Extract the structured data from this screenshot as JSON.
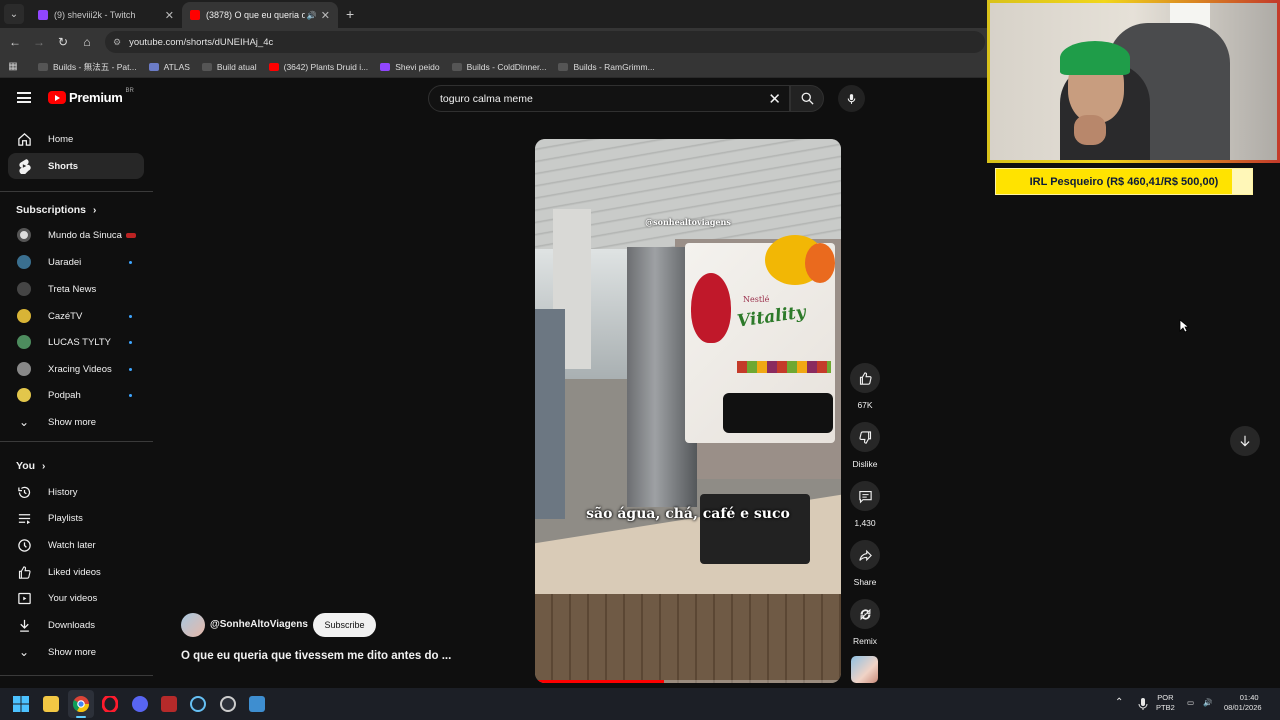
{
  "browser": {
    "tabs": [
      {
        "title": "(9) sheviii2k - Twitch",
        "active": false,
        "favicon_color": "#9146ff"
      },
      {
        "title": "(3878) O que eu queria que",
        "active": true,
        "favicon_color": "#ff0000"
      }
    ],
    "url": "youtube.com/shorts/dUNEIHAj_4c",
    "bookmarks": [
      {
        "label": "Builds - 無法五 - Pat...",
        "icon_color": "#1a1a1a"
      },
      {
        "label": "ATLAS",
        "icon_color": "#6b7cc7"
      },
      {
        "label": "Build atual",
        "icon_color": "#1a1a1a"
      },
      {
        "label": "(3642) Plants Druid i...",
        "icon_color": "#ff0000"
      },
      {
        "label": "Shevi peido",
        "icon_color": "#9146ff"
      },
      {
        "label": "Builds - ColdDinner...",
        "icon_color": "#1a1a1a"
      },
      {
        "label": "Builds - RamGrimm...",
        "icon_color": "#1a1a1a"
      }
    ]
  },
  "youtube": {
    "logo_text": "Premium",
    "logo_region": "BR",
    "search_query": "toguro calma meme",
    "sidebar": {
      "main": [
        {
          "label": "Home",
          "icon": "home-icon",
          "active": false
        },
        {
          "label": "Shorts",
          "icon": "shorts-icon",
          "active": true
        }
      ],
      "subscriptions_heading": "Subscriptions",
      "subscriptions": [
        {
          "label": "Mundo da Sinuca",
          "avatar_color": "#ddd",
          "badge": "live"
        },
        {
          "label": "Uaradei",
          "avatar_color": "#3a6f8f",
          "badge": "dot"
        },
        {
          "label": "Treta News",
          "avatar_color": "#444",
          "badge": ""
        },
        {
          "label": "CazéTV",
          "avatar_color": "#d8b436",
          "badge": "dot"
        },
        {
          "label": "LUCAS TYLTY",
          "avatar_color": "#4d8c5e",
          "badge": "dot"
        },
        {
          "label": "Xracing Videos",
          "avatar_color": "#888",
          "badge": "dot"
        },
        {
          "label": "Podpah",
          "avatar_color": "#e2c64b",
          "badge": "dot"
        }
      ],
      "subs_show_more": "Show more",
      "you_heading": "You",
      "you_items": [
        {
          "label": "History",
          "icon": "history-icon"
        },
        {
          "label": "Playlists",
          "icon": "playlists-icon"
        },
        {
          "label": "Watch later",
          "icon": "watch-later-icon"
        },
        {
          "label": "Liked videos",
          "icon": "like-icon"
        },
        {
          "label": "Your videos",
          "icon": "your-videos-icon"
        },
        {
          "label": "Downloads",
          "icon": "download-icon"
        }
      ],
      "you_show_more": "Show more"
    },
    "video": {
      "watermark": "@sonhealtoviagens",
      "brand": "Nestlé",
      "product": "Vitality",
      "caption": "são água, chá, café e suco",
      "progress": 0.42
    },
    "actions": {
      "likes": "67K",
      "dislike_label": "Dislike",
      "comments": "1,430",
      "share_label": "Share",
      "remix_label": "Remix"
    },
    "channel": {
      "handle": "@SonheAltoViagens",
      "subscribe_label": "Subscribe"
    },
    "title": "O que eu queria que tivessem me dito antes do ..."
  },
  "stream_overlay": {
    "goal_text": "IRL Pesqueiro (R$ 460,41/R$ 500,00)",
    "goal_progress": 0.92
  },
  "taskbar": {
    "lang_top": "POR",
    "lang_bottom": "PTB2",
    "time": "01:40",
    "date": "08/01/2026"
  }
}
